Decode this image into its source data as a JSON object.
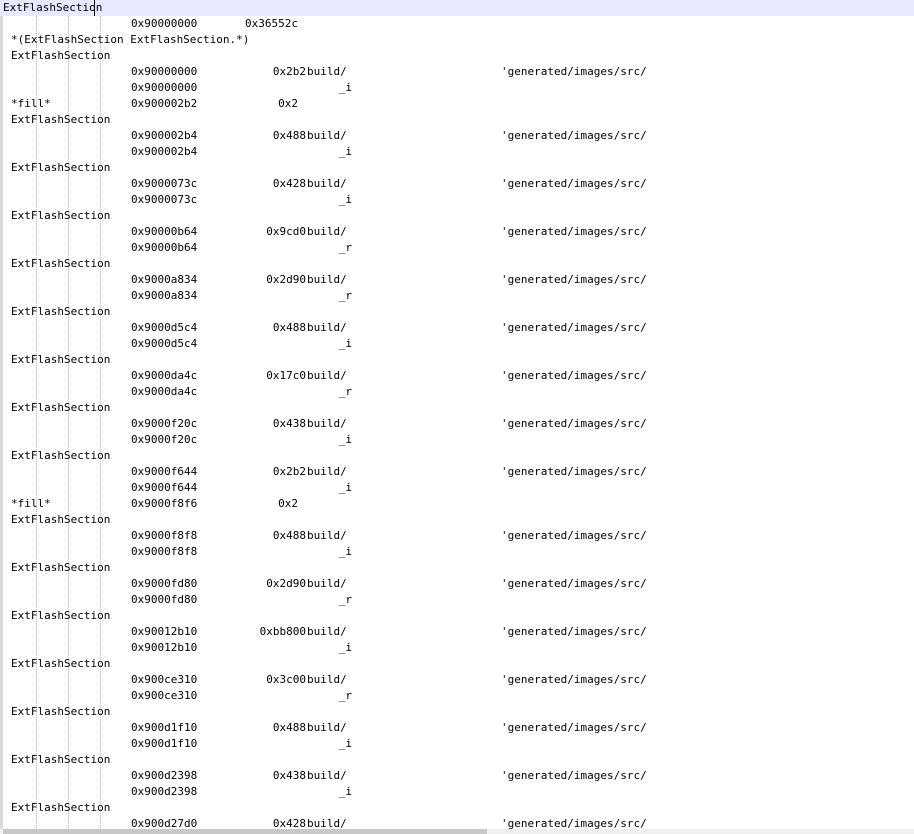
{
  "editor": {
    "lines": [
      {
        "name": "ExtFlashSection",
        "current": true
      },
      {
        "addr": "0x90000000",
        "size": "0x36552c"
      },
      {
        "name": "*(ExtFlashSection ExtFlashSection.*)"
      },
      {
        "name": "ExtFlashSection"
      },
      {
        "addr": "0x90000000",
        "size": "0x2b2",
        "file": "build/",
        "src": "'generated/images/src/"
      },
      {
        "addr": "0x90000000",
        "sym": "_i"
      },
      {
        "name": "*fill*",
        "addr": "0x900002b2",
        "size": "0x2"
      },
      {
        "name": "ExtFlashSection"
      },
      {
        "addr": "0x900002b4",
        "size": "0x488",
        "file": "build/",
        "src": "'generated/images/src/"
      },
      {
        "addr": "0x900002b4",
        "sym": "_i"
      },
      {
        "name": "ExtFlashSection"
      },
      {
        "addr": "0x9000073c",
        "size": "0x428",
        "file": "build/",
        "src": "'generated/images/src/"
      },
      {
        "addr": "0x9000073c",
        "sym": "_i"
      },
      {
        "name": "ExtFlashSection"
      },
      {
        "addr": "0x90000b64",
        "size": "0x9cd0",
        "file": "build/",
        "src": "'generated/images/src/"
      },
      {
        "addr": "0x90000b64",
        "sym": "_r"
      },
      {
        "name": "ExtFlashSection"
      },
      {
        "addr": "0x9000a834",
        "size": "0x2d90",
        "file": "build/",
        "src": "'generated/images/src/"
      },
      {
        "addr": "0x9000a834",
        "sym": "_r"
      },
      {
        "name": "ExtFlashSection"
      },
      {
        "addr": "0x9000d5c4",
        "size": "0x488",
        "file": "build/",
        "src": "'generated/images/src/"
      },
      {
        "addr": "0x9000d5c4",
        "sym": "_i"
      },
      {
        "name": "ExtFlashSection"
      },
      {
        "addr": "0x9000da4c",
        "size": "0x17c0",
        "file": "build/",
        "src": "'generated/images/src/"
      },
      {
        "addr": "0x9000da4c",
        "sym": "_r"
      },
      {
        "name": "ExtFlashSection"
      },
      {
        "addr": "0x9000f20c",
        "size": "0x438",
        "file": "build/",
        "src": "'generated/images/src/"
      },
      {
        "addr": "0x9000f20c",
        "sym": "_i"
      },
      {
        "name": "ExtFlashSection"
      },
      {
        "addr": "0x9000f644",
        "size": "0x2b2",
        "file": "build/",
        "src": "'generated/images/src/"
      },
      {
        "addr": "0x9000f644",
        "sym": "_i"
      },
      {
        "name": "*fill*",
        "addr": "0x9000f8f6",
        "size": "0x2"
      },
      {
        "name": "ExtFlashSection"
      },
      {
        "addr": "0x9000f8f8",
        "size": "0x488",
        "file": "build/",
        "src": "'generated/images/src/"
      },
      {
        "addr": "0x9000f8f8",
        "sym": "_i"
      },
      {
        "name": "ExtFlashSection"
      },
      {
        "addr": "0x9000fd80",
        "size": "0x2d90",
        "file": "build/",
        "src": "'generated/images/src/"
      },
      {
        "addr": "0x9000fd80",
        "sym": "_r"
      },
      {
        "name": "ExtFlashSection"
      },
      {
        "addr": "0x90012b10",
        "size": "0xbb800",
        "file": "build/",
        "src": "'generated/images/src/"
      },
      {
        "addr": "0x90012b10",
        "sym": "_i"
      },
      {
        "name": "ExtFlashSection"
      },
      {
        "addr": "0x900ce310",
        "size": "0x3c00",
        "file": "build/",
        "src": "'generated/images/src/"
      },
      {
        "addr": "0x900ce310",
        "sym": "_r"
      },
      {
        "name": "ExtFlashSection"
      },
      {
        "addr": "0x900d1f10",
        "size": "0x488",
        "file": "build/",
        "src": "'generated/images/src/"
      },
      {
        "addr": "0x900d1f10",
        "sym": "_i"
      },
      {
        "name": "ExtFlashSection"
      },
      {
        "addr": "0x900d2398",
        "size": "0x438",
        "file": "build/",
        "src": "'generated/images/src/"
      },
      {
        "addr": "0x900d2398",
        "sym": "_i"
      },
      {
        "name": "ExtFlashSection"
      },
      {
        "addr": "0x900d27d0",
        "size": "0x428",
        "file": "build/",
        "src": "'generated/images/src/"
      }
    ]
  }
}
